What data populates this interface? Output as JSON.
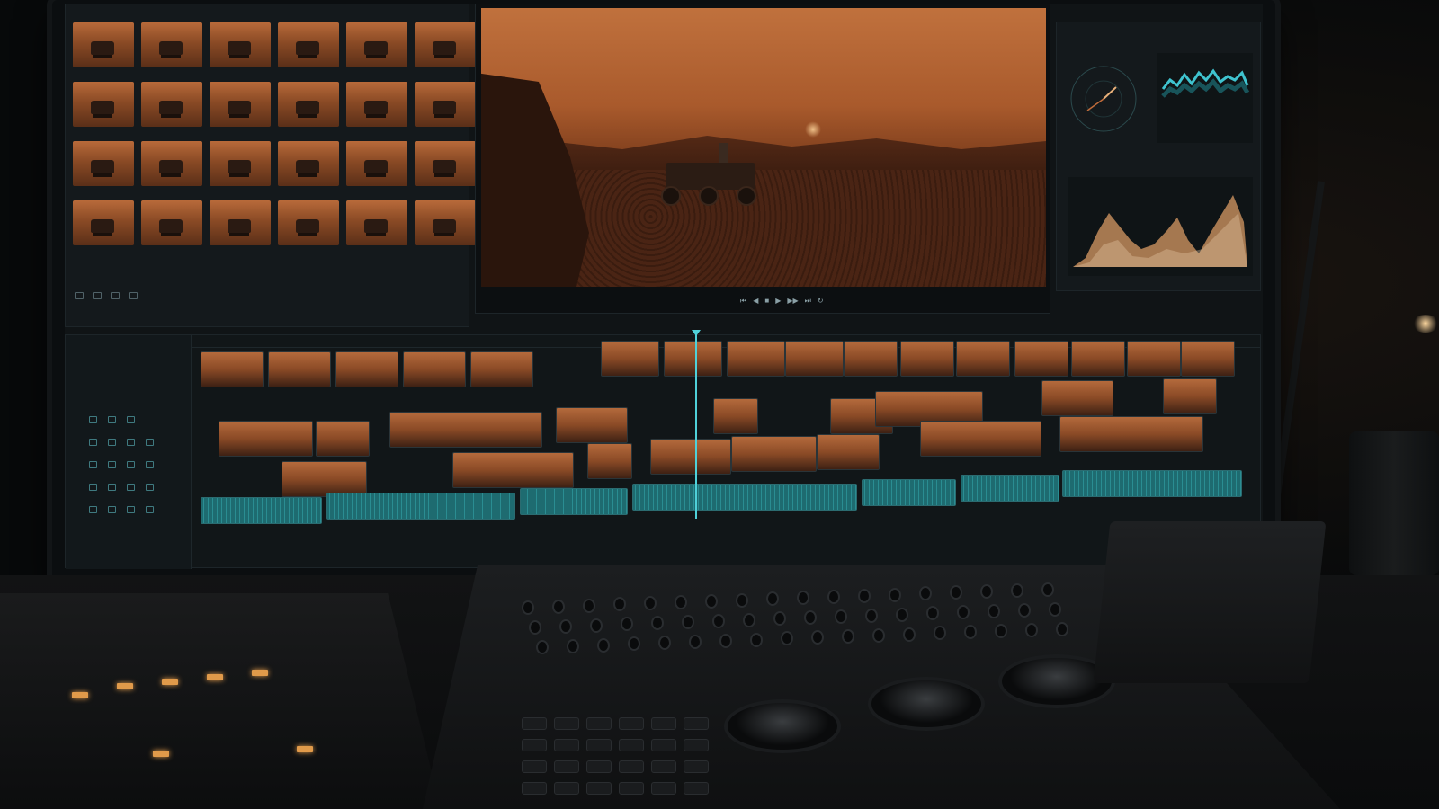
{
  "app": {
    "media_pool_label": "",
    "scopes_labels": [
      "",
      ""
    ]
  },
  "media_pool": {
    "thumbnail_count": 24
  },
  "viewer": {
    "timecode": ""
  },
  "colors": {
    "accent_teal": "#4fd1d9",
    "clip_orange": "#b46a3c",
    "audio_teal": "#2a8d92",
    "panel_bg": "#14191c",
    "amber_led": "#e09a4a"
  },
  "icons": {
    "transport": [
      "skip-back-icon",
      "step-back-icon",
      "stop-icon",
      "play-icon",
      "step-forward-icon",
      "skip-forward-icon",
      "loop-icon"
    ],
    "track_tools": [
      "video-track-icon",
      "lock-icon",
      "link-icon",
      "eye-icon"
    ]
  }
}
